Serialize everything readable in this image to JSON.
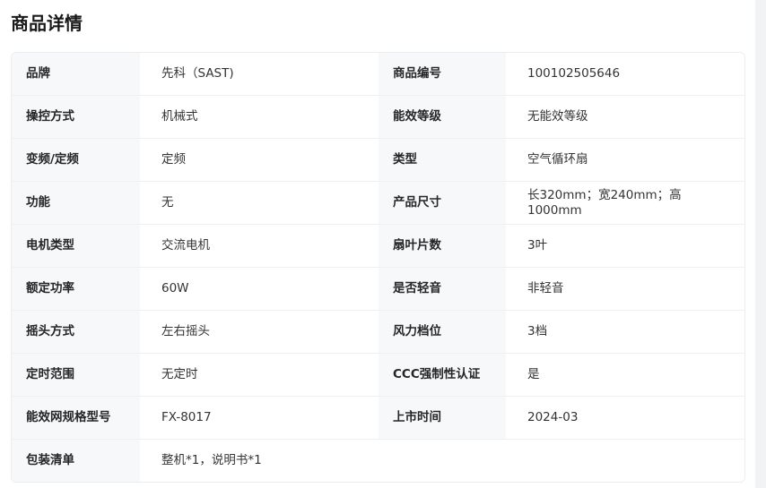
{
  "page": {
    "title": "商品详情"
  },
  "rows": [
    {
      "l1": "品牌",
      "v1": "先科（SAST)",
      "l2": "商品编号",
      "v2": "100102505646"
    },
    {
      "l1": "操控方式",
      "v1": "机械式",
      "l2": "能效等级",
      "v2": "无能效等级"
    },
    {
      "l1": "变频/定频",
      "v1": "定频",
      "l2": "类型",
      "v2": "空气循环扇"
    },
    {
      "l1": "功能",
      "v1": "无",
      "l2": "产品尺寸",
      "v2": "长320mm；宽240mm；高1000mm"
    },
    {
      "l1": "电机类型",
      "v1": "交流电机",
      "l2": "扇叶片数",
      "v2": "3叶"
    },
    {
      "l1": "额定功率",
      "v1": "60W",
      "l2": "是否轻音",
      "v2": "非轻音"
    },
    {
      "l1": "摇头方式",
      "v1": "左右摇头",
      "l2": "风力档位",
      "v2": "3档"
    },
    {
      "l1": "定时范围",
      "v1": "无定时",
      "l2": "CCC强制性认证",
      "v2": "是"
    },
    {
      "l1": "能效网规格型号",
      "v1": "FX-8017",
      "l2": "上市时间",
      "v2": "2024-03"
    }
  ],
  "last_row": {
    "label": "包装清单",
    "value": "整机*1，说明书*1"
  }
}
